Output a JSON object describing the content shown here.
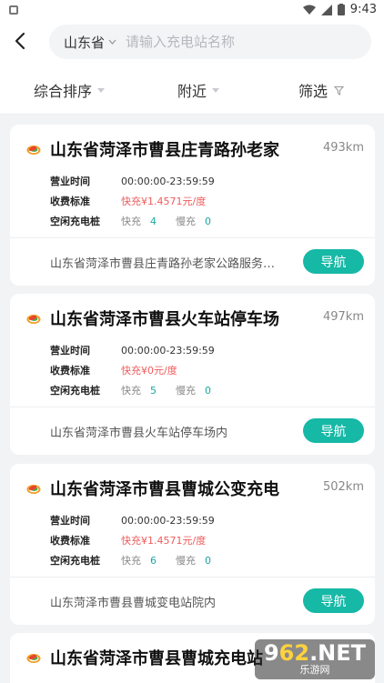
{
  "status_bar": {
    "time": "9:43"
  },
  "search": {
    "province": "山东省",
    "placeholder": "请输入充电站名称",
    "value": ""
  },
  "filters": {
    "sort": "综合排序",
    "nearby": "附近",
    "screen": "筛选"
  },
  "labels": {
    "hours": "营业时间",
    "fee": "收费标准",
    "idle": "空闲充电桩",
    "fast": "快充",
    "slow": "慢充",
    "nav": "导航"
  },
  "stations": [
    {
      "name": "山东省菏泽市曹县庄青路孙老家",
      "distance": "493km",
      "hours": "00:00:00-23:59:59",
      "price": "¥1.4571元/度",
      "fast_count": "4",
      "slow_count": "0",
      "address": "山东省菏泽市曹县庄青路孙老家公路服务…"
    },
    {
      "name": "山东省菏泽市曹县火车站停车场",
      "distance": "497km",
      "hours": "00:00:00-23:59:59",
      "price": "¥0元/度",
      "fast_count": "5",
      "slow_count": "0",
      "address": "山东省菏泽市曹县火车站停车场内"
    },
    {
      "name": "山东省菏泽市曹县曹城公变充电",
      "distance": "502km",
      "hours": "00:00:00-23:59:59",
      "price": "¥1.4571元/度",
      "fast_count": "6",
      "slow_count": "0",
      "address": "山东菏泽市曹县曹城变电站院内"
    },
    {
      "name": "山东省菏泽市曹县曹城充电站"
    }
  ],
  "watermark": {
    "brand_left": "9",
    "brand_accent": "62",
    "brand_right": ".NET",
    "sub": "乐游网"
  },
  "colors": {
    "accent": "#16b8a6",
    "price": "#ef5b5b",
    "count": "#1aa8a0"
  }
}
